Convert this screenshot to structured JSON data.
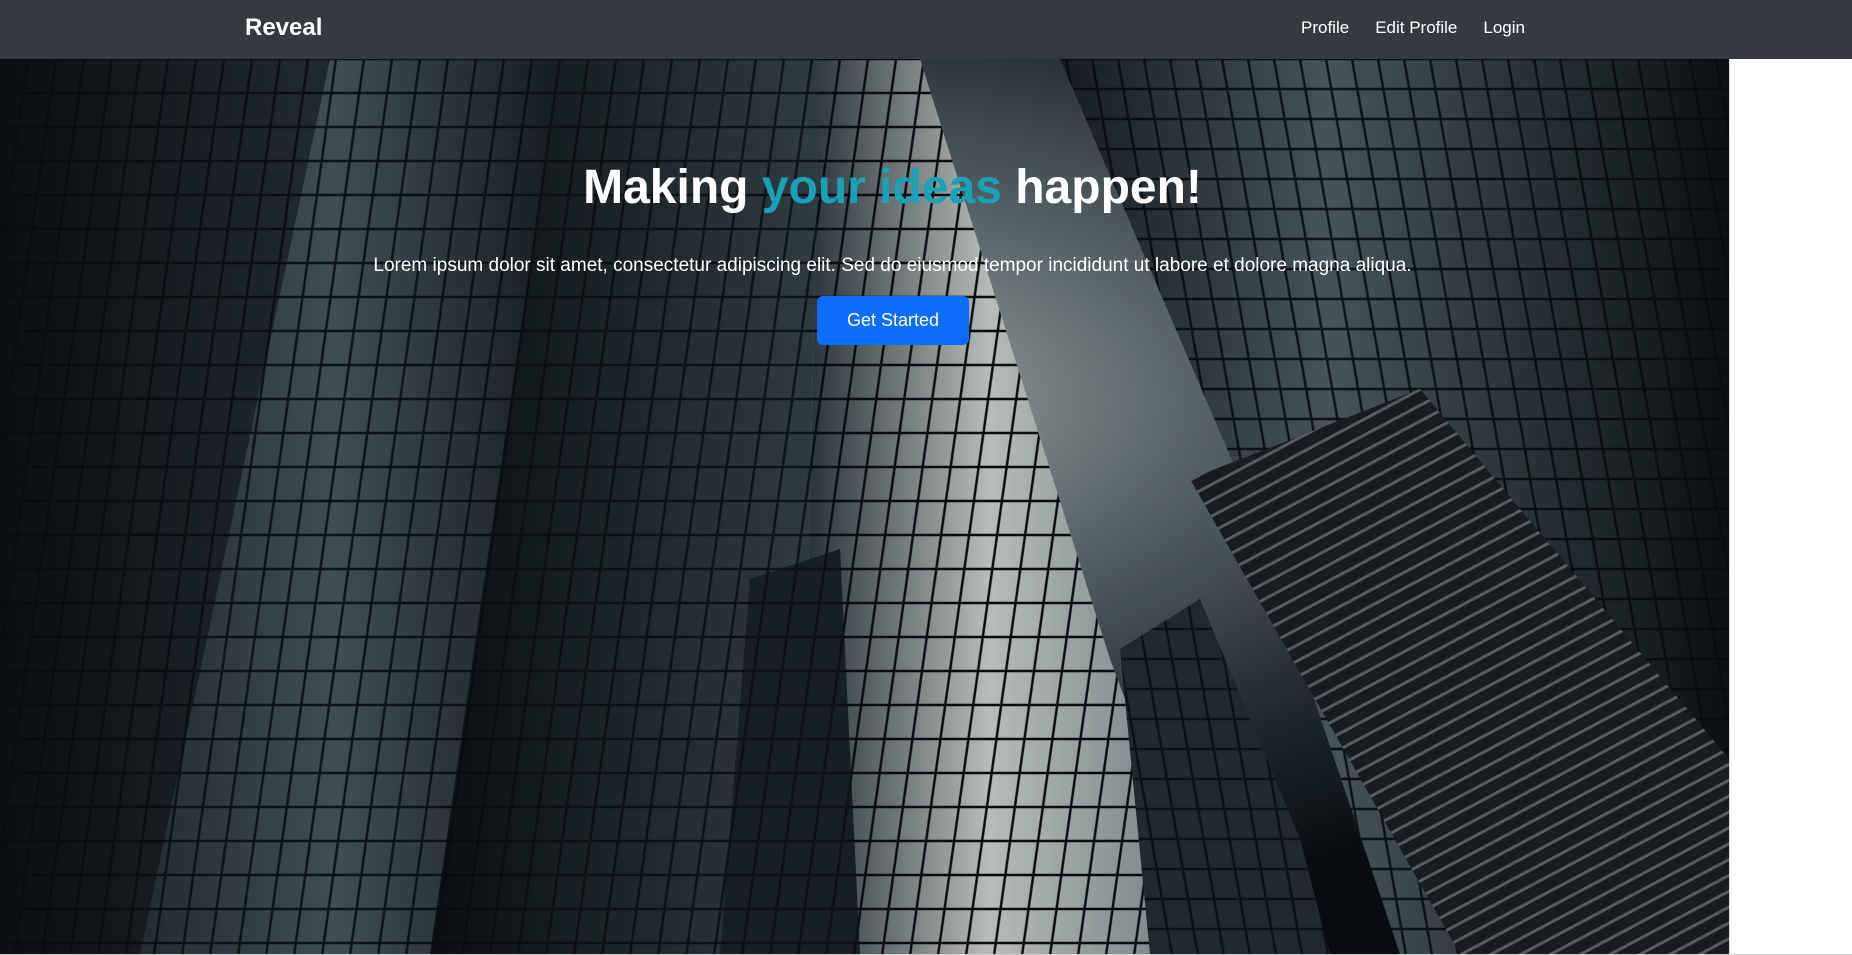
{
  "navbar": {
    "brand": "Reveal",
    "links": [
      "Profile",
      "Edit Profile",
      "Login"
    ]
  },
  "hero": {
    "headline_prefix": "Making ",
    "headline_accent": "your ideas",
    "headline_suffix": " happen!",
    "lead": "Lorem ipsum dolor sit amet, consectetur adipiscing elit. Sed do eiusmod tempor incididunt ut labore et dolore magna aliqua.",
    "cta_label": "Get Started"
  },
  "colors": {
    "navbar_bg": "#343a40",
    "accent": "#17a2b8",
    "button_bg": "#0d6efd"
  }
}
